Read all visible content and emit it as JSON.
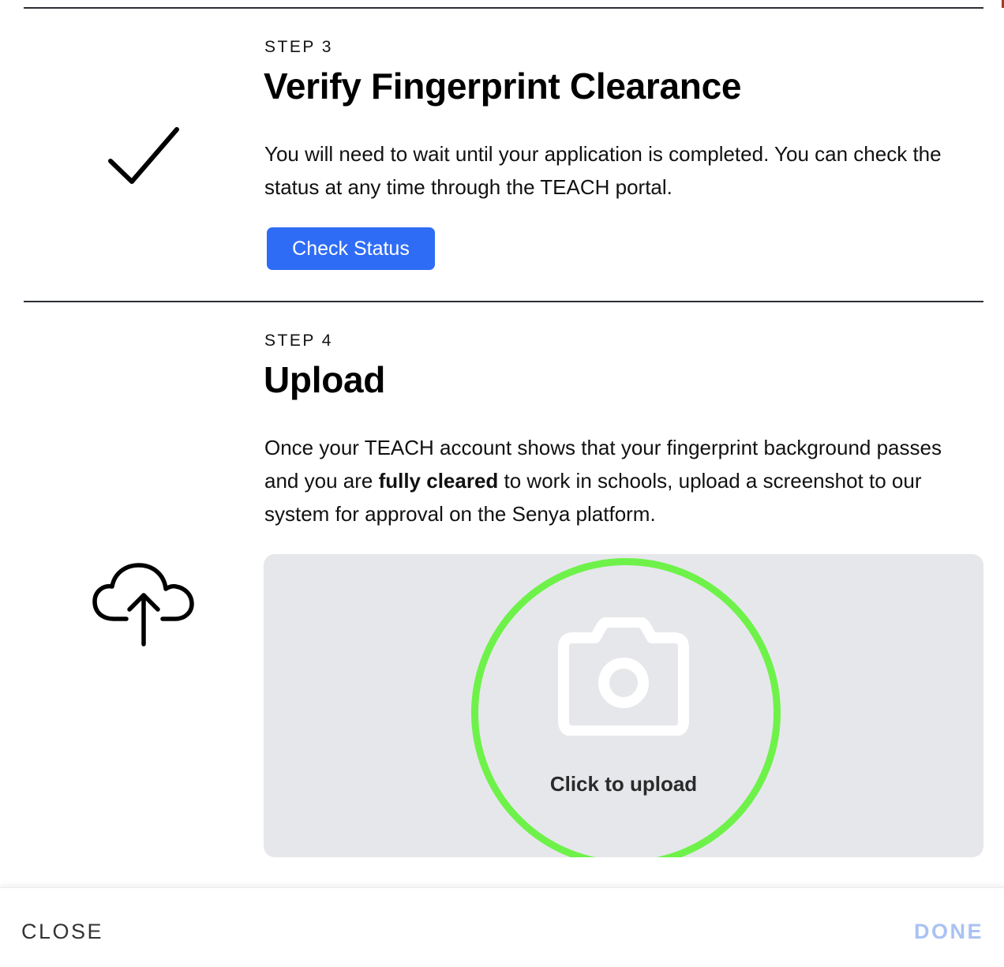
{
  "step3": {
    "label": "STEP 3",
    "title": "Verify Fingerprint Clearance",
    "description": "You will need to wait until your application is completed. You can check the status at any time through the TEACH portal.",
    "button_label": "Check Status",
    "icon": "checkmark-icon"
  },
  "step4": {
    "label": "STEP 4",
    "title": "Upload",
    "description_before": "Once your TEACH account shows that your fingerprint background passes and you are ",
    "description_bold": "fully cleared",
    "description_after": " to work in schools, upload a screenshot to our system for approval on the Senya platform.",
    "icon": "cloud-upload-icon",
    "upload_label": "Click to upload",
    "upload_icon": "camera-icon"
  },
  "footer": {
    "close_label": "CLOSE",
    "done_label": "DONE"
  },
  "colors": {
    "primary_button": "#2f6cf6",
    "upload_ring": "#6ef24a",
    "upload_bg": "#e6e7eb",
    "done_disabled": "#a9c2f2"
  }
}
